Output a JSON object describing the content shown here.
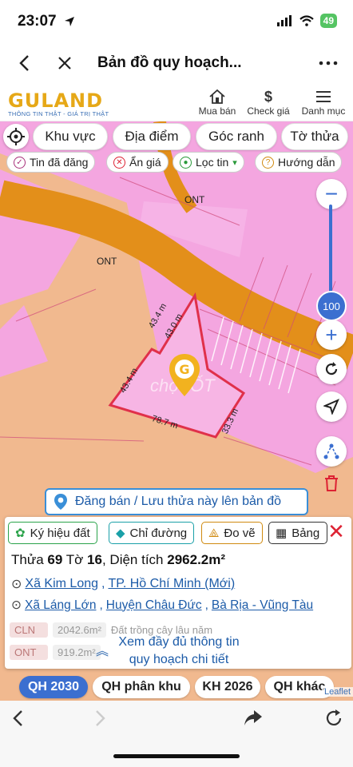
{
  "status": {
    "time": "23:07",
    "battery": "49"
  },
  "nav": {
    "title": "Bản đồ quy hoạch..."
  },
  "header": {
    "brand": "GULAND",
    "tagline": "THÔNG TIN THẬT - GIÁ TRỊ THẬT",
    "items": [
      {
        "label": "Mua bán",
        "icon": "house-icon"
      },
      {
        "label": "Check giá",
        "icon": "dollar-icon"
      },
      {
        "label": "Danh mục",
        "icon": "menu-icon"
      }
    ]
  },
  "filters": {
    "pills": [
      "Khu vực",
      "Địa điểm",
      "Góc ranh",
      "Tờ thửa"
    ],
    "chips": [
      "Tin đã đăng",
      "Ẩn giá",
      "Lọc tin",
      "Hướng dẫn"
    ]
  },
  "map": {
    "zone_labels": [
      "ONT",
      "ONT"
    ],
    "dims": [
      "43.4 m",
      "43.0 m",
      "43.4 m",
      "78.7 m",
      "33.3 m"
    ],
    "zoom_level": "100",
    "zoom_fraction": 0.72,
    "watermark": "chợTỐT"
  },
  "banner": {
    "text": "Đăng bán / Lưu thửa này lên bản đồ"
  },
  "panel": {
    "tools": [
      "Ký hiệu đất",
      "Chỉ đường",
      "Đo vẽ",
      "Bảng"
    ],
    "parcel_label": "Thửa",
    "parcel_no": "69",
    "sheet_label": "Tờ",
    "sheet_no": "16",
    "area_label": "Diện tích",
    "area": "2962.2m²",
    "addr_new": {
      "ward": "Xã Kim Long",
      "city": "TP. Hồ Chí Minh (Mới)"
    },
    "addr_old": {
      "ward": "Xã Láng Lớn",
      "district": "Huyện Châu Đức",
      "province": "Bà Rịa - Vũng Tàu"
    },
    "zones": [
      {
        "code": "CLN",
        "area": "2042.6m²",
        "desc": "Đất trồng cây lâu năm"
      },
      {
        "code": "ONT",
        "area": "919.2m²",
        "desc": ""
      }
    ],
    "more_line1": "Xem đầy đủ thông tin",
    "more_line2": "quy hoạch chi tiết"
  },
  "tabs": [
    "QH 2030",
    "QH phân khu",
    "KH 2026",
    "QH khác"
  ],
  "attribution": "Leaflet"
}
